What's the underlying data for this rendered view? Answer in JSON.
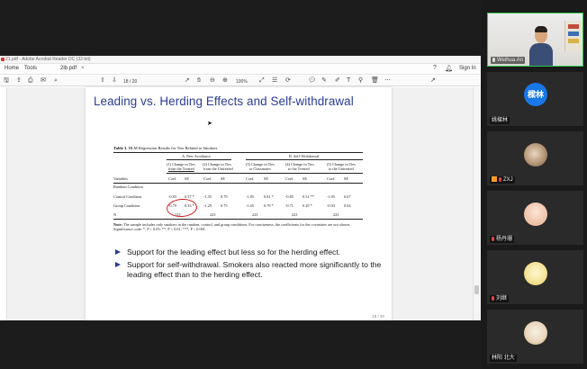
{
  "acrobat": {
    "window_title": "21.pdf - Adobe Acrobat Reader DC (32-bit)",
    "menu": {
      "home": "Home",
      "tools": "Tools",
      "tab": "2lb.pdf",
      "signin": "Sign In"
    },
    "zoom": "100%"
  },
  "slide": {
    "title": "Leading vs. Herding Effects and Self-withdrawal",
    "page_indicator": "18 / 20",
    "bullets": [
      "Support for the leading effect but less so for the herding effect.",
      "Support for self-withdrawal. Smokers also reacted more significantly to the leading effect than to the herding effect."
    ]
  },
  "table": {
    "caption_label": "Table 3.",
    "caption_text": "HLM Regression Results for Ties Related to Smokers",
    "groupA": "A. Peer Avoidance",
    "groupB": "B. Self-Withdrawal",
    "cols": {
      "c1a": "(1) Change in Ties",
      "c1b": "from the Treated",
      "c2a": "(2) Change in Ties",
      "c2b": "from the Untreated",
      "c3a": "(3) Change in Ties",
      "c3b": "to Classmates",
      "c4a": "(4) Change in Ties",
      "c4b": "to the Treated",
      "c5a": "(5) Change in Ties",
      "c5b": "to the Untreated"
    },
    "sub": {
      "variables": "Variables",
      "coef": "Coef.",
      "se": "SE"
    },
    "rows": {
      "random_label": "Random Condition",
      "control_label": "Control Condition",
      "group_label": "Group Condition",
      "n_label": "N",
      "control": [
        "-0.83",
        "0.37 *",
        "-1.35",
        "0.79",
        "-1.85",
        "0.81 *",
        "-0.85",
        "0.31 **",
        "-1.05",
        "0.67"
      ],
      "group": [
        "-0.79",
        "0.33 *",
        "-1.29",
        "0.75",
        "-1.65",
        "0.79 *",
        "-0.71",
        "0.29 *",
        "-0.93",
        "0.63"
      ],
      "n": [
        "223",
        "223",
        "223",
        "223",
        "223"
      ]
    },
    "note_label": "Note:",
    "note_text": "The sample includes only smokers in the random, control, and group conditions. For conciseness, the coefficients for the covariates are not shown. Significance code: *, P < 0.05; **, P < 0.01; ***, P < 0.001."
  },
  "participants": [
    {
      "name": "Weihua An",
      "kind": "video"
    },
    {
      "name": "姚樑林",
      "kind": "avatar",
      "initials": "樑林",
      "color": "#1977e8"
    },
    {
      "name": "ZXJ",
      "kind": "photo"
    },
    {
      "name": "杨丹珊",
      "kind": "photo"
    },
    {
      "name": "刘继",
      "kind": "photo"
    },
    {
      "name": "林阳 北大",
      "kind": "photo"
    }
  ]
}
